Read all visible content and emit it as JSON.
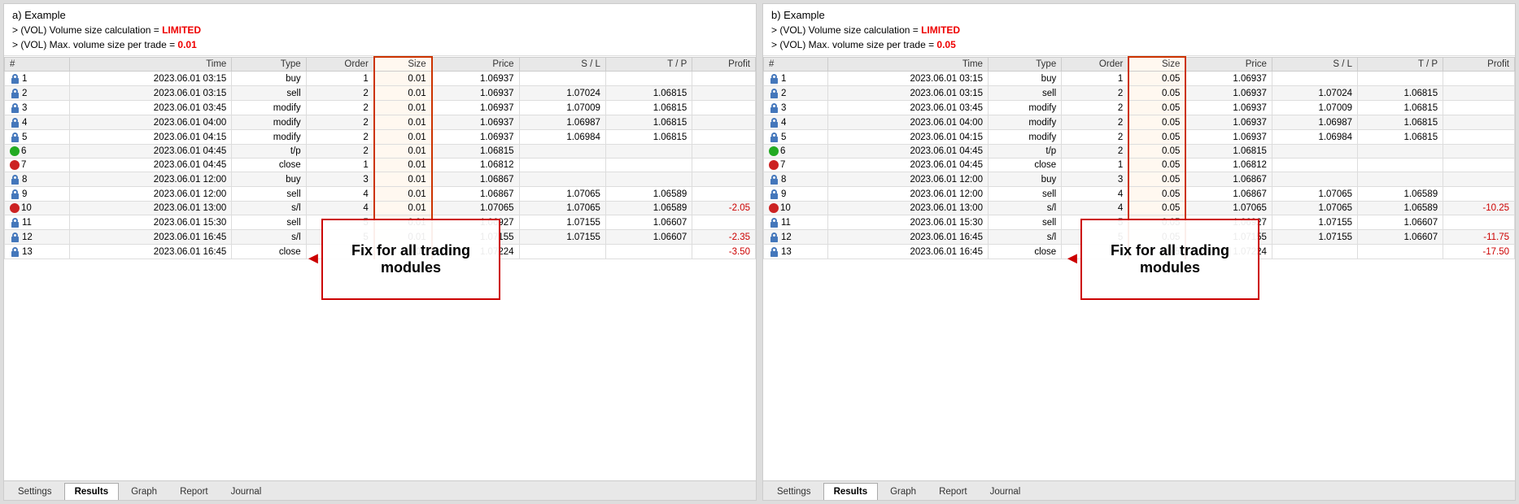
{
  "panelA": {
    "title": "a) Example",
    "line1": "> (VOL) Volume size calculation = LIMITED",
    "line2": "> (VOL) Max. volume size per trade = 0.01",
    "limited": "LIMITED",
    "maxVol": "0.01",
    "highlightText": "Fix for all trading\nmodules",
    "tabs": [
      "Settings",
      "Results",
      "Graph",
      "Report",
      "Journal"
    ],
    "activeTab": "Results",
    "columns": [
      "#",
      "Time",
      "Type",
      "Order",
      "Size",
      "Price",
      "S / L",
      "T / P",
      "Profit"
    ],
    "rows": [
      {
        "num": "1",
        "icon": "lock-blue",
        "time": "2023.06.01 03:15",
        "type": "buy",
        "order": "1",
        "size": "0.01",
        "price": "1.06937",
        "sl": "",
        "tp": "",
        "profit": ""
      },
      {
        "num": "2",
        "icon": "lock-blue",
        "time": "2023.06.01 03:15",
        "type": "sell",
        "order": "2",
        "size": "0.01",
        "price": "1.06937",
        "sl": "1.07024",
        "tp": "1.06815",
        "profit": ""
      },
      {
        "num": "3",
        "icon": "lock-blue",
        "time": "2023.06.01 03:45",
        "type": "modify",
        "order": "2",
        "size": "0.01",
        "price": "1.06937",
        "sl": "1.07009",
        "tp": "1.06815",
        "profit": ""
      },
      {
        "num": "4",
        "icon": "lock-blue",
        "time": "2023.06.01 04:00",
        "type": "modify",
        "order": "2",
        "size": "0.01",
        "price": "1.06937",
        "sl": "1.06987",
        "tp": "1.06815",
        "profit": ""
      },
      {
        "num": "5",
        "icon": "lock-blue",
        "time": "2023.06.01 04:15",
        "type": "modify",
        "order": "2",
        "size": "0.01",
        "price": "1.06937",
        "sl": "1.06984",
        "tp": "1.06815",
        "profit": ""
      },
      {
        "num": "6",
        "icon": "green-circle",
        "time": "2023.06.01 04:45",
        "type": "t/p",
        "order": "2",
        "size": "0.01",
        "price": "1.06815",
        "sl": "",
        "tp": "",
        "profit": ""
      },
      {
        "num": "7",
        "icon": "red-circle",
        "time": "2023.06.01 04:45",
        "type": "close",
        "order": "1",
        "size": "0.01",
        "price": "1.06812",
        "sl": "",
        "tp": "",
        "profit": ""
      },
      {
        "num": "8",
        "icon": "lock-blue",
        "time": "2023.06.01 12:00",
        "type": "buy",
        "order": "3",
        "size": "0.01",
        "price": "1.06867",
        "sl": "",
        "tp": "",
        "profit": ""
      },
      {
        "num": "9",
        "icon": "lock-blue",
        "time": "2023.06.01 12:00",
        "type": "sell",
        "order": "4",
        "size": "0.01",
        "price": "1.06867",
        "sl": "1.07065",
        "tp": "1.06589",
        "profit": ""
      },
      {
        "num": "10",
        "icon": "red-circle",
        "time": "2023.06.01 13:00",
        "type": "s/l",
        "order": "4",
        "size": "0.01",
        "price": "1.07065",
        "sl": "1.07065",
        "tp": "1.06589",
        "profit": "-2.05"
      },
      {
        "num": "11",
        "icon": "lock-blue",
        "time": "2023.06.01 15:30",
        "type": "sell",
        "order": "5",
        "size": "0.01",
        "price": "1.06927",
        "sl": "1.07155",
        "tp": "1.06607",
        "profit": ""
      },
      {
        "num": "12",
        "icon": "lock-blue",
        "time": "2023.06.01 16:45",
        "type": "s/l",
        "order": "5",
        "size": "0.01",
        "price": "1.07155",
        "sl": "1.07155",
        "tp": "1.06607",
        "profit": "-2.35"
      },
      {
        "num": "13",
        "icon": "lock-blue",
        "time": "2023.06.01 16:45",
        "type": "close",
        "order": "3",
        "size": "0.01",
        "price": "1.07224",
        "sl": "",
        "tp": "",
        "profit": "-3.50"
      }
    ]
  },
  "panelB": {
    "title": "b) Example",
    "line1": "> (VOL) Volume size calculation = LIMITED",
    "line2": "> (VOL) Max. volume size per trade = 0.05",
    "limited": "LIMITED",
    "maxVol": "0.05",
    "highlightText": "Fix for all trading\nmodules",
    "tabs": [
      "Settings",
      "Results",
      "Graph",
      "Report",
      "Journal"
    ],
    "activeTab": "Results",
    "columns": [
      "#",
      "Time",
      "Type",
      "Order",
      "Size",
      "Price",
      "S / L",
      "T / P",
      "Profit"
    ],
    "rows": [
      {
        "num": "1",
        "icon": "lock-blue",
        "time": "2023.06.01 03:15",
        "type": "buy",
        "order": "1",
        "size": "0.05",
        "price": "1.06937",
        "sl": "",
        "tp": "",
        "profit": ""
      },
      {
        "num": "2",
        "icon": "lock-blue",
        "time": "2023.06.01 03:15",
        "type": "sell",
        "order": "2",
        "size": "0.05",
        "price": "1.06937",
        "sl": "1.07024",
        "tp": "1.06815",
        "profit": ""
      },
      {
        "num": "3",
        "icon": "lock-blue",
        "time": "2023.06.01 03:45",
        "type": "modify",
        "order": "2",
        "size": "0.05",
        "price": "1.06937",
        "sl": "1.07009",
        "tp": "1.06815",
        "profit": ""
      },
      {
        "num": "4",
        "icon": "lock-blue",
        "time": "2023.06.01 04:00",
        "type": "modify",
        "order": "2",
        "size": "0.05",
        "price": "1.06937",
        "sl": "1.06987",
        "tp": "1.06815",
        "profit": ""
      },
      {
        "num": "5",
        "icon": "lock-blue",
        "time": "2023.06.01 04:15",
        "type": "modify",
        "order": "2",
        "size": "0.05",
        "price": "1.06937",
        "sl": "1.06984",
        "tp": "1.06815",
        "profit": ""
      },
      {
        "num": "6",
        "icon": "green-circle",
        "time": "2023.06.01 04:45",
        "type": "t/p",
        "order": "2",
        "size": "0.05",
        "price": "1.06815",
        "sl": "",
        "tp": "",
        "profit": ""
      },
      {
        "num": "7",
        "icon": "red-circle",
        "time": "2023.06.01 04:45",
        "type": "close",
        "order": "1",
        "size": "0.05",
        "price": "1.06812",
        "sl": "",
        "tp": "",
        "profit": ""
      },
      {
        "num": "8",
        "icon": "lock-blue",
        "time": "2023.06.01 12:00",
        "type": "buy",
        "order": "3",
        "size": "0.05",
        "price": "1.06867",
        "sl": "",
        "tp": "",
        "profit": ""
      },
      {
        "num": "9",
        "icon": "lock-blue",
        "time": "2023.06.01 12:00",
        "type": "sell",
        "order": "4",
        "size": "0.05",
        "price": "1.06867",
        "sl": "1.07065",
        "tp": "1.06589",
        "profit": ""
      },
      {
        "num": "10",
        "icon": "red-circle",
        "time": "2023.06.01 13:00",
        "type": "s/l",
        "order": "4",
        "size": "0.05",
        "price": "1.07065",
        "sl": "1.07065",
        "tp": "1.06589",
        "profit": "-10.25"
      },
      {
        "num": "11",
        "icon": "lock-blue",
        "time": "2023.06.01 15:30",
        "type": "sell",
        "order": "5",
        "size": "0.05",
        "price": "1.06927",
        "sl": "1.07155",
        "tp": "1.06607",
        "profit": ""
      },
      {
        "num": "12",
        "icon": "lock-blue",
        "time": "2023.06.01 16:45",
        "type": "s/l",
        "order": "5",
        "size": "0.05",
        "price": "1.07155",
        "sl": "1.07155",
        "tp": "1.06607",
        "profit": "-11.75"
      },
      {
        "num": "13",
        "icon": "lock-blue",
        "time": "2023.06.01 16:45",
        "type": "close",
        "order": "3",
        "size": "0.05",
        "price": "1.07224",
        "sl": "",
        "tp": "",
        "profit": "-17.50"
      }
    ]
  }
}
